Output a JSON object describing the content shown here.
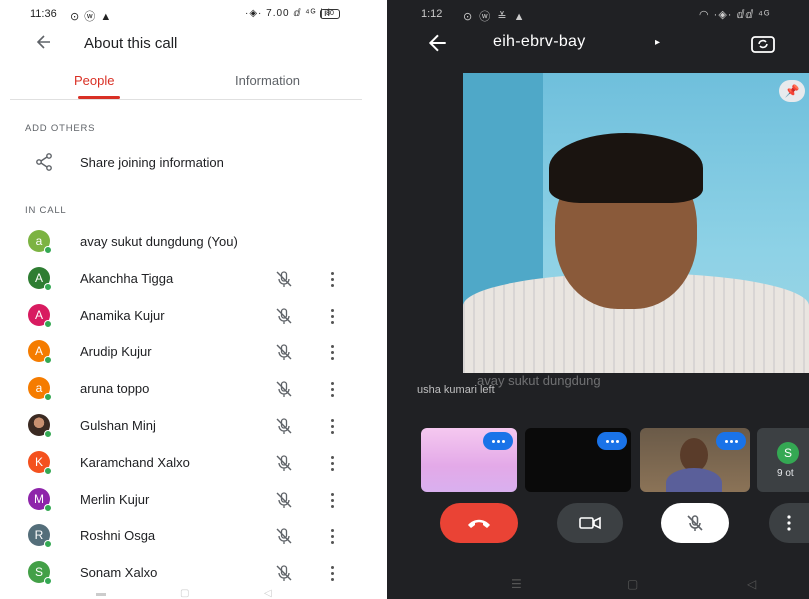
{
  "left": {
    "status": {
      "time": "11:36",
      "icons": "⊙ ⓦ ▲",
      "right": "·◈· 7.00 ⅆ ⁴ᴳ |ıl",
      "battery": "80"
    },
    "header": {
      "title": "About this call"
    },
    "tabs": [
      {
        "label": "People",
        "active": true
      },
      {
        "label": "Information",
        "active": false
      }
    ],
    "add_section": "ADD OTHERS",
    "share_label": "Share joining information",
    "in_call_section": "IN CALL",
    "participants": [
      {
        "initial": "a",
        "name": "avay sukut dungdung (You)",
        "color": "#7cb342",
        "is_you": true
      },
      {
        "initial": "A",
        "name": "Akanchha Tigga",
        "color": "#2e7d32"
      },
      {
        "initial": "A",
        "name": "Anamika Kujur",
        "color": "#d81b60"
      },
      {
        "initial": "A",
        "name": "Arudip Kujur",
        "color": "#f57c00"
      },
      {
        "initial": "a",
        "name": "aruna toppo",
        "color": "#f57c00"
      },
      {
        "initial": "",
        "name": "Gulshan Minj",
        "color": "#795548",
        "photo": true
      },
      {
        "initial": "K",
        "name": "Karamchand Xalxo",
        "color": "#f4511e"
      },
      {
        "initial": "M",
        "name": "Merlin Kujur",
        "color": "#8e24aa"
      },
      {
        "initial": "R",
        "name": "Roshni Osga",
        "color": "#546e7a"
      },
      {
        "initial": "S",
        "name": "Sonam Xalxo",
        "color": "#43a047"
      }
    ],
    "icons": {
      "back": "arrow-back-icon",
      "share": "share-icon",
      "mute": "mic-off-icon",
      "more": "more-vert-icon"
    }
  },
  "right": {
    "status": {
      "time": "1:12",
      "icons": "⊙ ⓦ ≚ ▲",
      "right": "◠ ·◈· ⅆⅆ ⁴ᴳ"
    },
    "meeting_code": "eih-ebrv-bay",
    "caret": "▸",
    "main_video_name": "avay sukut dungdung",
    "toast": "usha kumari left",
    "overflow_tile": {
      "initial": "S",
      "label": "9 ot"
    },
    "colors": {
      "end_call": "#ea4335",
      "speaking": "#1a73e8",
      "background": "#202124"
    }
  }
}
